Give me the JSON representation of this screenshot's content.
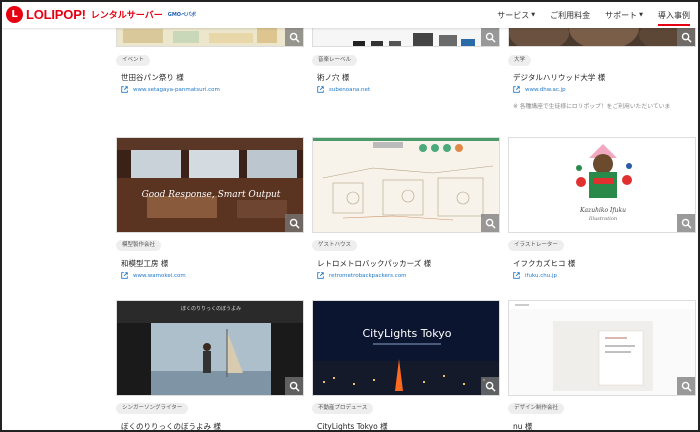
{
  "brand": {
    "logo": "LOLIPOP!",
    "subtitle": "レンタルサーバー",
    "gmo": "GMOペパボ",
    "accent": "#e60012"
  },
  "nav": [
    {
      "label": "サービス",
      "caret": true,
      "active": false
    },
    {
      "label": "ご利用料金",
      "caret": false,
      "active": false
    },
    {
      "label": "サポート",
      "caret": true,
      "active": false
    },
    {
      "label": "導入事例",
      "caret": false,
      "active": true
    }
  ],
  "cards": [
    {
      "category": "イベント",
      "title": "世田谷パン祭り 様",
      "url": "www.setagaya-panmatsuri.com"
    },
    {
      "category": "音楽レーベル",
      "title": "術ノ穴 様",
      "url": "subenoana.net"
    },
    {
      "category": "大学",
      "title": "デジタルハリウッド大学 様",
      "url": "www.dhw.ac.jp",
      "note": "※ 各種講座で生徒様にロリポップ！をご利用いただいていま"
    },
    {
      "category": "模型製作会社",
      "title": "和模型工房 様",
      "url": "www.wamokei.com",
      "image_text": "Good Response, Smart Output"
    },
    {
      "category": "ゲストハウス",
      "title": "レトロメトロバックパッカーズ 様",
      "url": "retrometrobackpackers.com"
    },
    {
      "category": "イラストレーター",
      "title": "イフクカズヒコ 様",
      "url": "ifuku.chu.jp"
    },
    {
      "category": "シンガーソングライター",
      "title": "ぼくのりりっくのぼうよみ 様",
      "url": "",
      "image_text": "ぼくのりりっくのぼうよみ"
    },
    {
      "category": "不動産プロデュース",
      "title": "CityLights Tokyo 様",
      "url": "",
      "image_text": "CityLights Tokyo"
    },
    {
      "category": "デザイン制作会社",
      "title": "nu 様",
      "url": ""
    }
  ]
}
